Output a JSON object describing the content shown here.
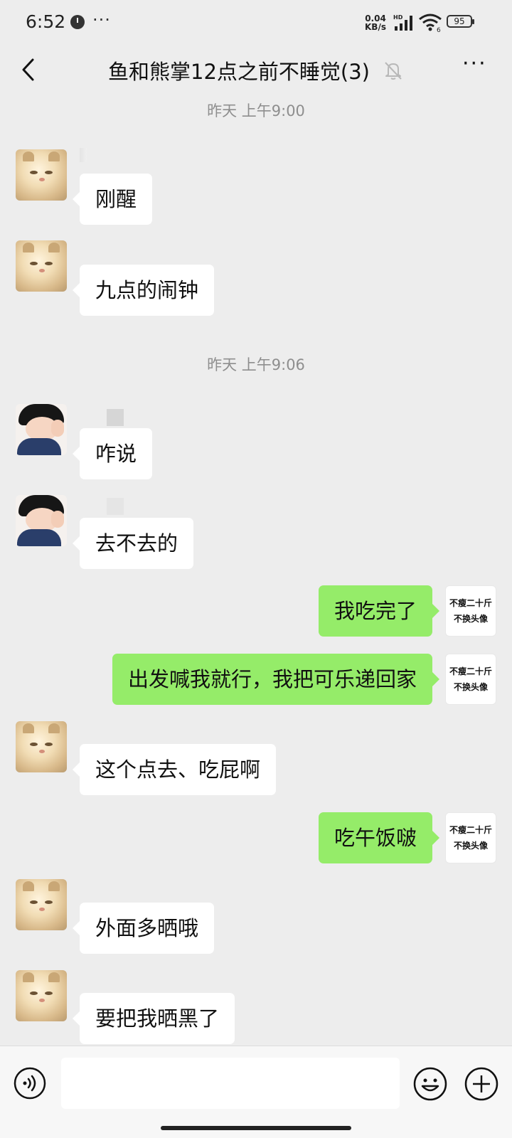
{
  "status_bar": {
    "time": "6:52",
    "more": "···",
    "speed_value": "0.04",
    "speed_unit": "KB/s",
    "hd": "HD",
    "wifi_sub": "6",
    "battery": "95"
  },
  "header": {
    "title": "鱼和熊掌12点之前不睡觉(3)",
    "more": "···"
  },
  "messages": {
    "ts1": "昨天 上午9:00",
    "m1": "刚醒",
    "m2": "九点的闹钟",
    "ts2": "昨天 上午9:06",
    "m3": "咋说",
    "m4": "去不去的",
    "m5": "我吃完了",
    "m6": "出发喊我就行，我把可乐递回家",
    "m7": "这个点去、吃屁啊",
    "m8": "吃午饭啵",
    "m9": "外面多晒哦",
    "m10": "要把我晒黑了"
  },
  "my_avatar": {
    "line1": "不瘦二十斤",
    "line2": "不换头像"
  },
  "input": {
    "value": ""
  },
  "colors": {
    "background": "#ededed",
    "incoming_bubble": "#ffffff",
    "outgoing_bubble": "#95ec69",
    "timestamp": "#8e8e8e"
  },
  "icons": {
    "back": "chevron-left-icon",
    "mute": "bell-off-icon",
    "more": "more-dots-icon",
    "voice": "voice-icon",
    "emoji": "emoji-icon",
    "plus": "plus-icon"
  }
}
